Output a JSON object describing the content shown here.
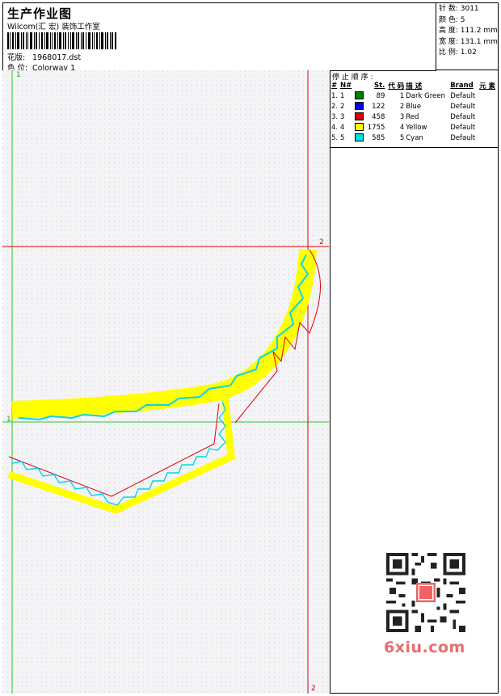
{
  "header": {
    "title": "生产作业图",
    "company": "Wilcom(汇 宏) 装饰工作室",
    "design_label": "花版:",
    "design_value": "1968017.dst",
    "colorway_label": "色 位:",
    "colorway_value": "Colorway 1"
  },
  "stats": {
    "stitches": "针 数:  3011",
    "colors": "颜 色:  5",
    "height": "高 度:  111.2 mm",
    "width": "宽 度:  131.1 mm",
    "scale": "比 例:  1.02"
  },
  "stop_sequence": {
    "heading": "停 止 顺 序 :",
    "columns": [
      "#",
      "N#",
      "St.",
      "代 码",
      "描 述",
      "Brand",
      "元 素"
    ],
    "rows": [
      {
        "idx": "1.",
        "n": "1",
        "color": "#008000",
        "stitches": "89",
        "code": "1",
        "desc": "Dark Green",
        "brand": "Default"
      },
      {
        "idx": "2.",
        "n": "2",
        "color": "#0000e0",
        "stitches": "122",
        "code": "2",
        "desc": "Blue",
        "brand": "Default"
      },
      {
        "idx": "3.",
        "n": "3",
        "color": "#e00000",
        "stitches": "458",
        "code": "3",
        "desc": "Red",
        "brand": "Default"
      },
      {
        "idx": "4.",
        "n": "4",
        "color": "#ffff00",
        "stitches": "1755",
        "code": "4",
        "desc": "Yellow",
        "brand": "Default"
      },
      {
        "idx": "5.",
        "n": "5",
        "color": "#00e0e0",
        "stitches": "585",
        "code": "5",
        "desc": "Cyan",
        "brand": "Default"
      }
    ]
  },
  "guides": {
    "green_label_top": "1",
    "green_label_left": "1",
    "red_label_right": "2",
    "red_label_bottom": "2"
  },
  "watermark": {
    "text": "6xiu.com",
    "seal": "汉程网"
  }
}
